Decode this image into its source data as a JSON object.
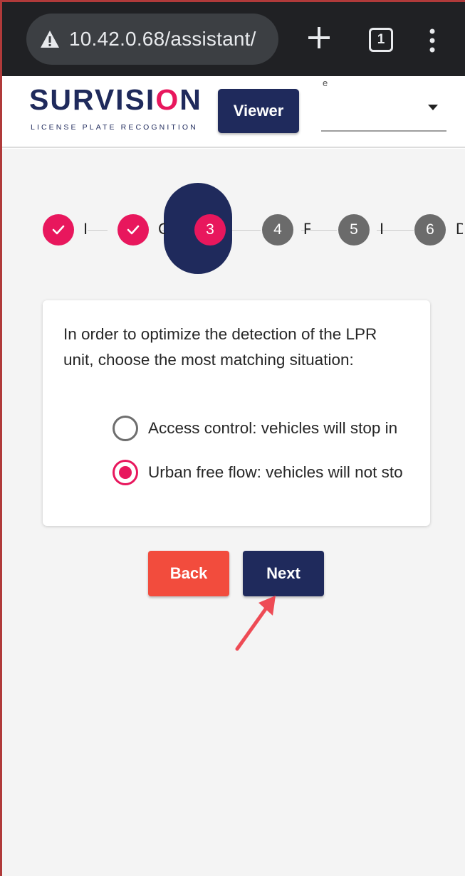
{
  "browser": {
    "url": "10.42.0.68/assistant/",
    "tab_count": "1",
    "icons": [
      "warning-icon",
      "plus-icon",
      "tab-switcher-icon",
      "overflow-menu-icon"
    ]
  },
  "header": {
    "logo_word_start": "SURVISI",
    "logo_word_o": "O",
    "logo_word_end": "N",
    "logo_tagline": "LICENSE PLATE RECOGNITION",
    "viewer_label": "Viewer",
    "select_label": "e"
  },
  "stepper": {
    "steps": [
      {
        "state": "done",
        "number": "",
        "label": "I"
      },
      {
        "state": "done",
        "number": "",
        "label": "C"
      },
      {
        "state": "active",
        "number": "3",
        "label": ""
      },
      {
        "state": "todo",
        "number": "4",
        "label": "F"
      },
      {
        "state": "todo",
        "number": "5",
        "label": "I"
      },
      {
        "state": "todo",
        "number": "6",
        "label": "D"
      }
    ]
  },
  "card": {
    "intro": "In order to optimize the detection of the LPR unit, choose the most matching situation:",
    "options": [
      {
        "label": "Access control: vehicles will stop in",
        "checked": false
      },
      {
        "label": "Urban free flow: vehicles will not sto",
        "checked": true
      }
    ]
  },
  "actions": {
    "back_label": "Back",
    "next_label": "Next"
  },
  "colors": {
    "brand_navy": "#1f2a5c",
    "brand_pink": "#e8175d",
    "back_red": "#f24c3d",
    "annotation_arrow": "#ee4b55"
  }
}
